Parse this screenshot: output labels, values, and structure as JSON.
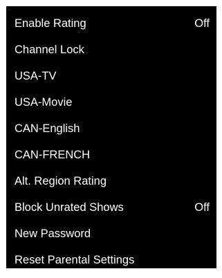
{
  "menu": {
    "items": [
      {
        "label": "Enable Rating",
        "value": "Off"
      },
      {
        "label": "Channel Lock",
        "value": ""
      },
      {
        "label": "USA-TV",
        "value": ""
      },
      {
        "label": "USA-Movie",
        "value": ""
      },
      {
        "label": "CAN-English",
        "value": ""
      },
      {
        "label": "CAN-FRENCH",
        "value": ""
      },
      {
        "label": "Alt. Region Rating",
        "value": ""
      },
      {
        "label": "Block Unrated Shows",
        "value": "Off"
      },
      {
        "label": "New Password",
        "value": ""
      },
      {
        "label": "Reset Parental Settings",
        "value": ""
      }
    ]
  },
  "colors": {
    "panel_background": "#000000",
    "text": "#ffffff",
    "page_background": "#ffffff"
  }
}
